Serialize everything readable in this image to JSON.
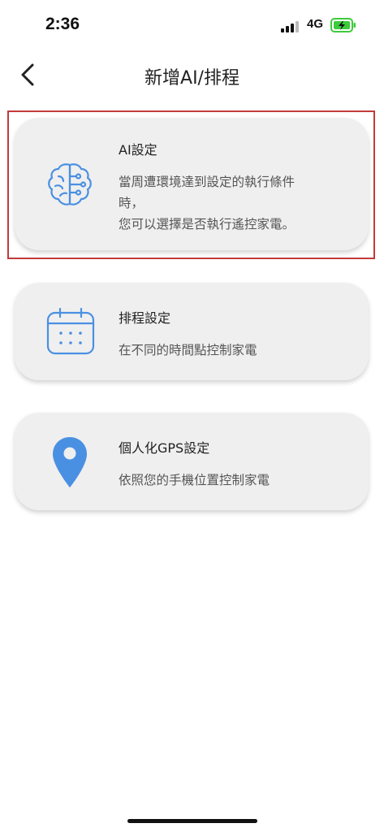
{
  "status_bar": {
    "time": "2:36",
    "network": "4G"
  },
  "nav": {
    "title": "新增AI/排程"
  },
  "cards": [
    {
      "title": "AI設定",
      "description_line1": "當周遭環境達到設定的執行條件",
      "description_line2": "時，",
      "description_line3": "您可以選擇是否執行遙控家電。",
      "icon": "brain-icon"
    },
    {
      "title": "排程設定",
      "description": "在不同的時間點控制家電",
      "icon": "calendar-icon"
    },
    {
      "title": "個人化GPS設定",
      "description": "依照您的手機位置控制家電",
      "icon": "location-pin-icon"
    }
  ],
  "colors": {
    "accent": "#4a90e2",
    "card_bg": "#efefef",
    "highlight": "#c23a3a",
    "battery": "#3ccb3c"
  }
}
